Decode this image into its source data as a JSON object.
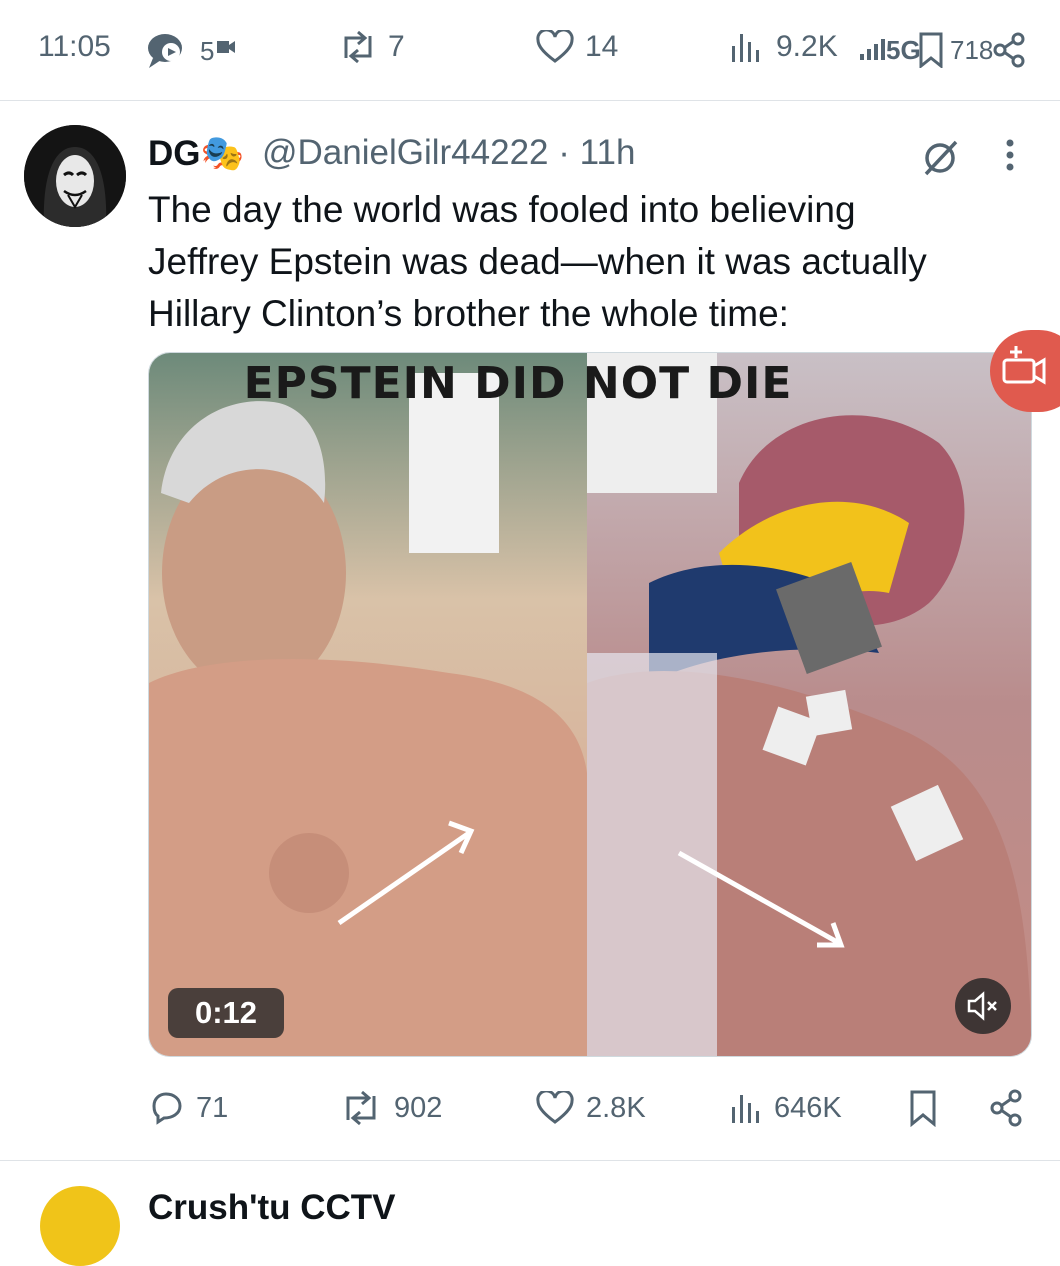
{
  "status_bar": {
    "time": "11:05",
    "message_badge": "5",
    "reposts": "7",
    "likes": "14",
    "views": "9.2K",
    "network": "5G",
    "battery": "718"
  },
  "tweet": {
    "display_name": "DG🎭",
    "handle_time": "@DanielGilr44222 · 11h",
    "text_lines": [
      "The day the world was fooled into believing",
      "Jeffrey Epstein was dead—when it was actually",
      "Hillary Clinton’s brother the whole time:"
    ],
    "media": {
      "caption": "EPSTEIN DID NOT DIE",
      "duration": "0:12"
    },
    "actions": {
      "replies": "71",
      "reposts": "902",
      "likes": "2.8K",
      "views": "646K"
    }
  },
  "next_tweet": {
    "display_name_partial": "Crush'tu CCTV"
  },
  "icons": [
    "message-icon",
    "camera-icon",
    "repost-icon",
    "heart-icon",
    "views-icon",
    "signal-icon",
    "bookmark-icon",
    "share-icon",
    "grok-icon",
    "more-icon",
    "mute-icon",
    "video-call-icon",
    "reply-icon",
    "verified-icon"
  ],
  "colors": {
    "text": "#0f1419",
    "muted": "#536471",
    "accent": "#1d9bf0",
    "float_button": "#e05a4e"
  }
}
